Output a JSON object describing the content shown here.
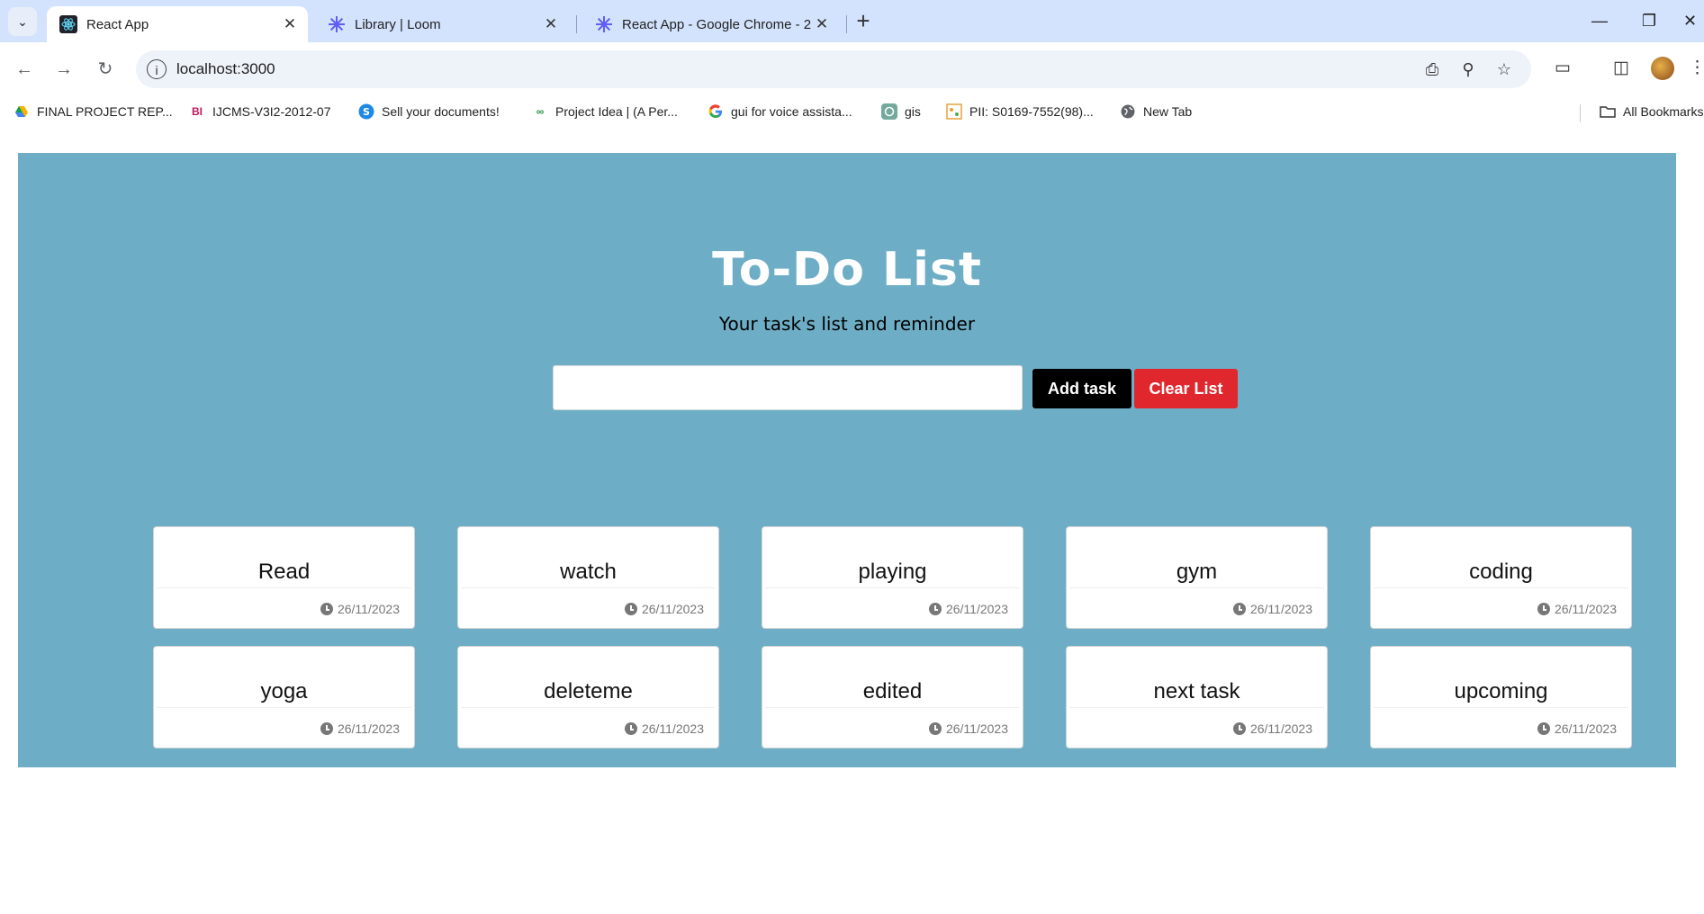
{
  "browser": {
    "tabs": [
      {
        "title": "React App",
        "active": true,
        "icon": "react-icon"
      },
      {
        "title": "Library | Loom",
        "active": false,
        "icon": "loom-icon"
      },
      {
        "title": "React App - Google Chrome - 2",
        "active": false,
        "icon": "loom-icon"
      }
    ],
    "url": "localhost:3000",
    "bookmarks": [
      {
        "label": "FINAL PROJECT REP...",
        "icon": "drive-icon"
      },
      {
        "label": "IJCMS-V3I2-2012-07",
        "icon": "doc-icon"
      },
      {
        "label": "Sell your documents!",
        "icon": "s-icon"
      },
      {
        "label": "Project Idea | (A Per...",
        "icon": "gfg-icon"
      },
      {
        "label": "gui for voice assista...",
        "icon": "google-icon"
      },
      {
        "label": "gis",
        "icon": "openai-icon"
      },
      {
        "label": "PII: S0169-7552(98)...",
        "icon": "pdf-icon"
      },
      {
        "label": "New Tab",
        "icon": "globe-icon"
      }
    ],
    "all_bookmarks_label": "All Bookmarks",
    "accent_color": "#d3e3fd"
  },
  "app": {
    "title": "To-Do List",
    "subtitle": "Your task's list and reminder",
    "input_value": "",
    "add_label": "Add task",
    "clear_label": "Clear List",
    "background_color": "#6daec6",
    "clear_color": "#e0272d",
    "tasks": [
      {
        "name": "Read",
        "date": "26/11/2023"
      },
      {
        "name": "watch",
        "date": "26/11/2023"
      },
      {
        "name": "playing",
        "date": "26/11/2023"
      },
      {
        "name": "gym",
        "date": "26/11/2023"
      },
      {
        "name": "coding",
        "date": "26/11/2023"
      },
      {
        "name": "yoga",
        "date": "26/11/2023"
      },
      {
        "name": "deleteme",
        "date": "26/11/2023"
      },
      {
        "name": "edited",
        "date": "26/11/2023"
      },
      {
        "name": "next task",
        "date": "26/11/2023"
      },
      {
        "name": "upcoming",
        "date": "26/11/2023"
      }
    ]
  }
}
